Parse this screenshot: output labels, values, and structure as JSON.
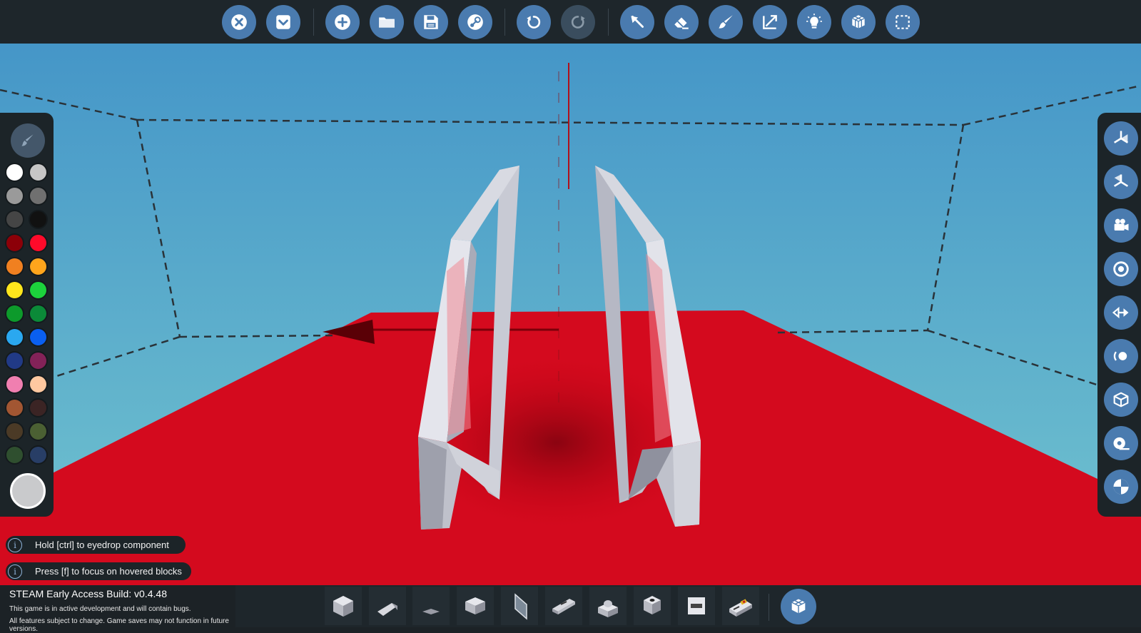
{
  "toolbar": {
    "buttons": [
      {
        "name": "close-button",
        "icon": "close-circle-icon"
      },
      {
        "name": "collapse-button",
        "icon": "chevron-down-box-icon"
      },
      {
        "name": "new-button",
        "icon": "plus-circle-icon"
      },
      {
        "name": "open-button",
        "icon": "folder-icon"
      },
      {
        "name": "save-button",
        "icon": "floppy-disk-icon"
      },
      {
        "name": "steam-button",
        "icon": "steam-icon"
      },
      {
        "name": "undo-button",
        "icon": "undo-icon"
      },
      {
        "name": "redo-button",
        "icon": "redo-icon",
        "disabled": true
      },
      {
        "name": "select-tool-button",
        "icon": "cursor-arrow-icon"
      },
      {
        "name": "eraser-tool-button",
        "icon": "eraser-icon"
      },
      {
        "name": "paint-tool-button",
        "icon": "paintbrush-icon"
      },
      {
        "name": "scale-tool-button",
        "icon": "resize-arrows-icon"
      },
      {
        "name": "light-button",
        "icon": "lightbulb-icon"
      },
      {
        "name": "blocks-button",
        "icon": "blocks-icon"
      },
      {
        "name": "marquee-select-button",
        "icon": "dashed-selection-icon"
      }
    ]
  },
  "palette": {
    "picker_icon": "paint-picker-icon",
    "swatches": [
      "#ffffff",
      "#c6c6c6",
      "#9a9a9a",
      "#707070",
      "#454545",
      "#111111",
      "#8c0008",
      "#ff0a2a",
      "#f08020",
      "#ffa51c",
      "#ffe61c",
      "#1cd23c",
      "#0d9a2b",
      "#0b8a38",
      "#2aa8f0",
      "#0a5ff0",
      "#213a86",
      "#832258",
      "#f07fb0",
      "#ffc8a0",
      "#a25632",
      "#3b2424",
      "#4b3a26",
      "#4b6033",
      "#2f4f2f",
      "#283e66"
    ],
    "selected_color": "#c9cacc"
  },
  "right_panel": {
    "buttons": [
      {
        "name": "view-perspective-button",
        "icon": "axis-gizmo-icon"
      },
      {
        "name": "view-iso-button",
        "icon": "axis-gizmo-alt-icon"
      },
      {
        "name": "camera-button",
        "icon": "camera-icon"
      },
      {
        "name": "focus-target-button",
        "icon": "target-icon"
      },
      {
        "name": "mirror-button",
        "icon": "mirror-arrows-icon"
      },
      {
        "name": "gravity-button",
        "icon": "orbit-icon"
      },
      {
        "name": "box-view-button",
        "icon": "cube-outline-icon"
      },
      {
        "name": "measure-button",
        "icon": "tape-measure-icon"
      },
      {
        "name": "center-of-mass-button",
        "icon": "center-of-mass-icon"
      }
    ]
  },
  "hints": [
    {
      "text": "Hold [ctrl] to eyedrop component",
      "icon": "info-icon"
    },
    {
      "text": "Press [f] to focus on hovered blocks",
      "icon": "info-icon"
    }
  ],
  "build_info": {
    "title": "STEAM Early Access Build: v0.4.48",
    "line1": "This game is in active development and will contain bugs.",
    "line2": "All features subject to change. Game saves may not function in future versions."
  },
  "block_bar": {
    "blocks": [
      {
        "name": "cube-block",
        "icon": "cube-block-icon"
      },
      {
        "name": "wedge-block",
        "icon": "wedge-block-icon"
      },
      {
        "name": "flat-wedge-block",
        "icon": "flat-wedge-block-icon"
      },
      {
        "name": "slope-block",
        "icon": "slope-block-icon"
      },
      {
        "name": "panel-block",
        "icon": "panel-block-icon"
      },
      {
        "name": "hinge-block",
        "icon": "hinge-block-icon"
      },
      {
        "name": "dome-block",
        "icon": "dome-block-icon"
      },
      {
        "name": "socket-block",
        "icon": "socket-block-icon"
      },
      {
        "name": "plate-block",
        "icon": "plate-block-icon"
      },
      {
        "name": "switch-block",
        "icon": "switch-block-icon"
      }
    ],
    "selected_icon": "blocks-icon"
  },
  "colors": {
    "accent": "#4a7baf",
    "sky_top": "#4a9acb",
    "sky_bottom": "#6fc0cf",
    "ground": "#d40a1e",
    "panel": "#1c2428"
  }
}
